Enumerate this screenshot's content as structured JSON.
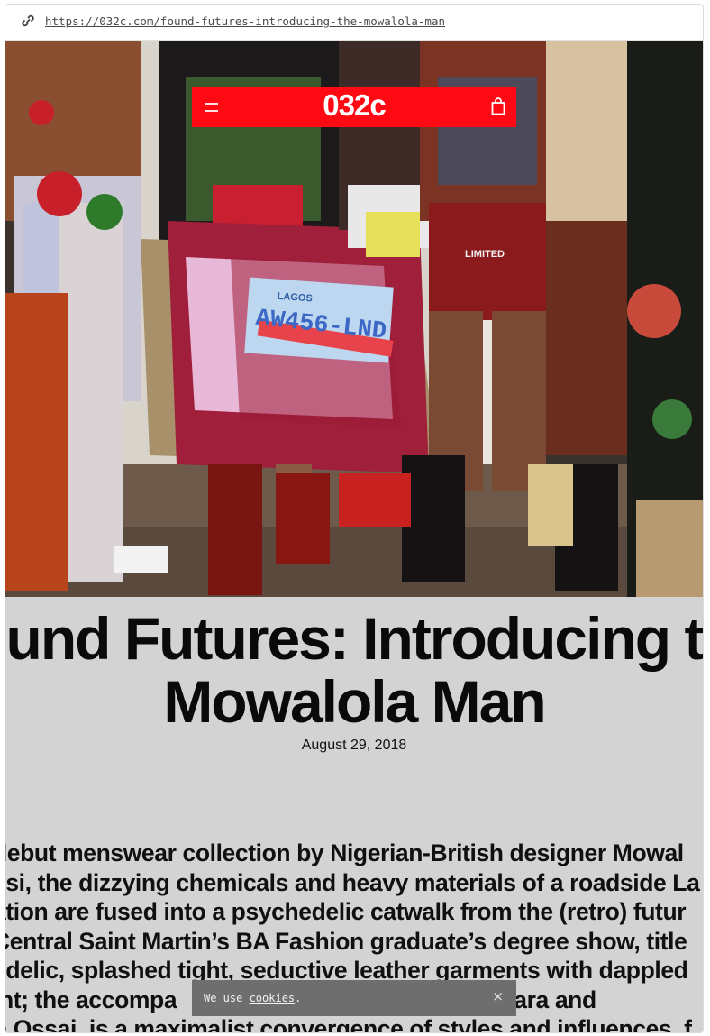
{
  "browser": {
    "url": "https://032c.com/found-futures-introducing-the-mowalola-man"
  },
  "header": {
    "logo": "032c"
  },
  "hero": {
    "plate_text_top": "LAGOS",
    "plate_text": "AW456-LND",
    "skirt_print": "LIMITED"
  },
  "article": {
    "title_line_1": "ound Futures: Introducing th",
    "title_line_2": "Mowalola Man",
    "date": "August 29, 2018",
    "body_lines": [
      "debut menswear collection by Nigerian-British designer Mowal",
      "esi, the dizzying chemicals and heavy materials of a roadside La",
      "ation are fused into a psychedelic catwalk from the (retro) futur",
      "Central Saint Martin’s BA Fashion graduate’s degree show, title",
      "edelic, splashed tight, seductive leather garments with dappled",
      "int; the accompa                                    ahim Kamara and",
      "h Ossai, is a maximalist convergence of styles and influences, f"
    ]
  },
  "cookie_banner": {
    "text_prefix": "We use ",
    "link": "cookies",
    "text_suffix": ".",
    "close": "×"
  },
  "colors": {
    "brand_red": "#ff0a14",
    "page_bg": "#d3d3d3",
    "cookie_bg": "#6e6e6e"
  }
}
